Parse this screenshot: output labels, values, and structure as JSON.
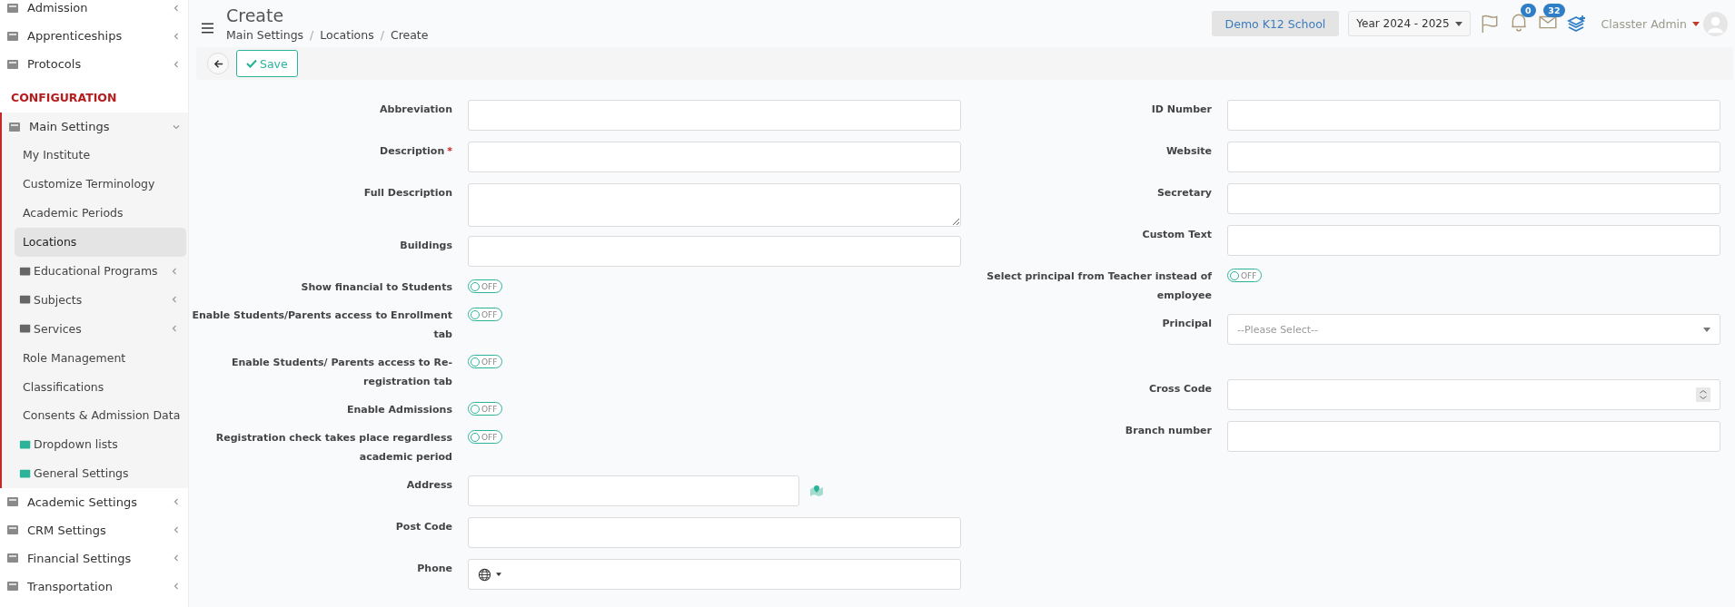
{
  "sidebar": {
    "items": [
      {
        "kind": "group",
        "label": "Admission",
        "expanded": false
      },
      {
        "kind": "group",
        "label": "Apprenticeships",
        "expanded": false
      },
      {
        "kind": "group",
        "label": "Protocols",
        "expanded": false
      },
      {
        "kind": "section",
        "label": "CONFIGURATION"
      },
      {
        "kind": "group",
        "label": "Main Settings",
        "expanded": true,
        "children": [
          {
            "kind": "link",
            "label": "My Institute",
            "selected": false
          },
          {
            "kind": "link",
            "label": "Customize Terminology",
            "selected": false
          },
          {
            "kind": "link",
            "label": "Academic Periods",
            "selected": false
          },
          {
            "kind": "link",
            "label": "Locations",
            "selected": true
          },
          {
            "kind": "icon-group",
            "label": "Educational Programs",
            "selected": false
          },
          {
            "kind": "icon-group",
            "label": "Subjects",
            "selected": false
          },
          {
            "kind": "icon-group",
            "label": "Services",
            "selected": false
          },
          {
            "kind": "link",
            "label": "Role Management",
            "selected": false
          },
          {
            "kind": "link",
            "label": "Classifications",
            "selected": false
          },
          {
            "kind": "link",
            "label": "Consents & Admission Data",
            "selected": false
          },
          {
            "kind": "icon-link",
            "label": "Dropdown lists",
            "selected": false
          },
          {
            "kind": "icon-link",
            "label": "General Settings",
            "selected": false
          }
        ]
      },
      {
        "kind": "group",
        "label": "Academic Settings",
        "expanded": false
      },
      {
        "kind": "group",
        "label": "CRM Settings",
        "expanded": false
      },
      {
        "kind": "group",
        "label": "Financial Settings",
        "expanded": false
      },
      {
        "kind": "group",
        "label": "Transportation",
        "expanded": false
      }
    ]
  },
  "header": {
    "title": "Create",
    "breadcrumb": [
      "Main Settings",
      "Locations",
      "Create"
    ],
    "separator": "/",
    "school": "Demo K12 School",
    "year": "Year 2024 - 2025",
    "notifications": "0",
    "messages": "32",
    "user": "Classter Admin"
  },
  "toolbar": {
    "save": "Save"
  },
  "form": {
    "left": [
      {
        "kind": "text",
        "label": "Abbreviation"
      },
      {
        "kind": "text",
        "label": "Description",
        "required": true,
        "required_mark": "*"
      },
      {
        "kind": "textarea",
        "label": "Full Description"
      },
      {
        "kind": "text",
        "label": "Buildings"
      },
      {
        "kind": "toggle",
        "label": "Show financial to Students",
        "on": false,
        "state": "OFF"
      },
      {
        "kind": "toggle",
        "label": "Enable Students/Parents access to Enrollment tab",
        "on": false,
        "state": "OFF"
      },
      {
        "kind": "toggle",
        "label": "Enable Students/ Parents access to Re-registration tab",
        "on": false,
        "state": "OFF"
      },
      {
        "kind": "toggle",
        "label": "Enable Admissions",
        "on": false,
        "state": "OFF"
      },
      {
        "kind": "toggle",
        "label": "Registration check takes place regardless academic period",
        "on": false,
        "state": "OFF"
      },
      {
        "kind": "address",
        "label": "Address"
      },
      {
        "kind": "text",
        "label": "Post Code"
      },
      {
        "kind": "phone",
        "label": "Phone"
      }
    ],
    "right": [
      {
        "kind": "text",
        "label": "ID Number"
      },
      {
        "kind": "text",
        "label": "Website"
      },
      {
        "kind": "text",
        "label": "Secretary"
      },
      {
        "kind": "text",
        "label": "Custom Text"
      },
      {
        "kind": "toggle",
        "label": "Select principal from Teacher instead of employee",
        "on": false,
        "state": "OFF"
      },
      {
        "kind": "select",
        "label": "Principal",
        "placeholder": "--Please Select--"
      },
      {
        "kind": "number",
        "label": "Cross Code"
      },
      {
        "kind": "text",
        "label": "Branch number"
      }
    ]
  }
}
